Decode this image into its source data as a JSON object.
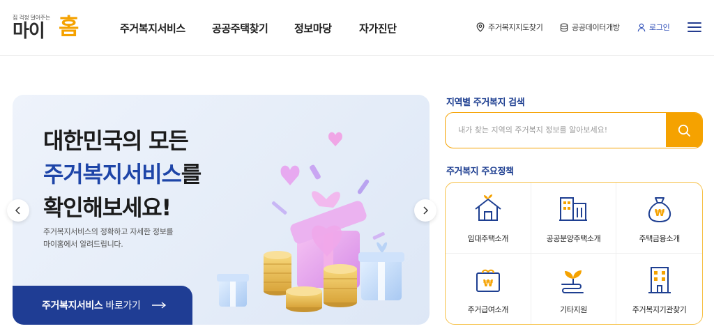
{
  "header": {
    "logo_tagline": "집 걱정 덜어주는",
    "logo_text": "마이",
    "logo_accent": "홈",
    "nav": [
      {
        "label": "주거복지서비스"
      },
      {
        "label": "공공주택찾기"
      },
      {
        "label": "정보마당"
      },
      {
        "label": "자가진단"
      }
    ],
    "utils": {
      "map_label": "주거복지지도찾기",
      "data_label": "공공데이터개방",
      "login_label": "로그인"
    }
  },
  "hero": {
    "title_line1": "대한민국의 모든",
    "title_highlight": "주거복지서비스",
    "title_line2_suffix": "를",
    "title_line3": "확인해보세요!",
    "desc_line1": "주거복지서비스의 정확하고 자세한 정보를",
    "desc_line2": "마이홈에서 알려드립니다.",
    "cta_bold": "주거복지서비스",
    "cta_rest": "바로가기"
  },
  "search": {
    "title": "지역별 주거복지 검색",
    "placeholder": "내가 찾는 지역의 주거복지 정보를 알아보세요!"
  },
  "policies": {
    "title": "주거복지 주요정책",
    "items": [
      {
        "label": "임대주택소개",
        "icon": "house-sprout-icon"
      },
      {
        "label": "공공분양주택소개",
        "icon": "apartment-buildings-icon"
      },
      {
        "label": "주택금융소개",
        "icon": "money-bag-won-icon"
      },
      {
        "label": "주거급여소개",
        "icon": "wallet-won-icon"
      },
      {
        "label": "기타지원",
        "icon": "sprout-support-icon"
      },
      {
        "label": "주거복지기관찾기",
        "icon": "office-building-icon"
      }
    ]
  },
  "colors": {
    "brand_navy": "#1f3d94",
    "brand_orange": "#f5a200",
    "hero_bg": "#e4ecf8",
    "accent_blue": "#1e45a8"
  }
}
